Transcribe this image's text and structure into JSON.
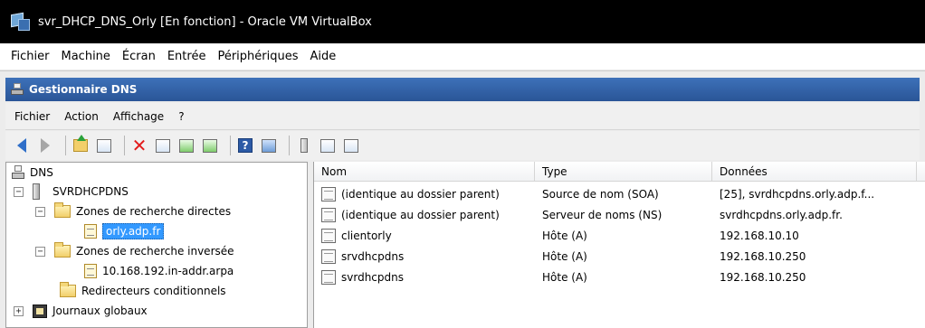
{
  "window": {
    "title": "svr_DHCP_DNS_Orly [En fonction] - Oracle VM VirtualBox"
  },
  "vbox_menu": [
    "Fichier",
    "Machine",
    "Écran",
    "Entrée",
    "Périphériques",
    "Aide"
  ],
  "mmc": {
    "title": "Gestionnaire DNS",
    "menu": [
      "Fichier",
      "Action",
      "Affichage",
      "?"
    ],
    "toolbar_icons": [
      "back-arrow-icon",
      "forward-arrow-icon",
      "up-folder-icon",
      "show-hide-tree-icon",
      "delete-icon",
      "properties-icon",
      "refresh-icon",
      "export-list-icon",
      "help-icon",
      "view-icon",
      "server-icon",
      "new-record-icon",
      "records-icon"
    ]
  },
  "tree": {
    "root": "DNS",
    "server": "SVRDHCPDNS",
    "forward_zones": "Zones de recherche directes",
    "selected_zone": "orly.adp.fr",
    "reverse_zones": "Zones de recherche inversée",
    "reverse_zone": "10.168.192.in-addr.arpa",
    "conditional_forwarders": "Redirecteurs conditionnels",
    "global_logs": "Journaux globaux"
  },
  "list": {
    "columns": [
      "Nom",
      "Type",
      "Données"
    ],
    "rows": [
      {
        "name": "(identique au dossier parent)",
        "type": "Source de nom (SOA)",
        "data": "[25], svrdhcpdns.orly.adp.f..."
      },
      {
        "name": "(identique au dossier parent)",
        "type": "Serveur de noms (NS)",
        "data": "svrdhcpdns.orly.adp.fr."
      },
      {
        "name": "clientorly",
        "type": "Hôte (A)",
        "data": "192.168.10.10"
      },
      {
        "name": "srvdhcpdns",
        "type": "Hôte (A)",
        "data": "192.168.10.250"
      },
      {
        "name": "svrdhcpdns",
        "type": "Hôte (A)",
        "data": "192.168.10.250"
      }
    ]
  }
}
